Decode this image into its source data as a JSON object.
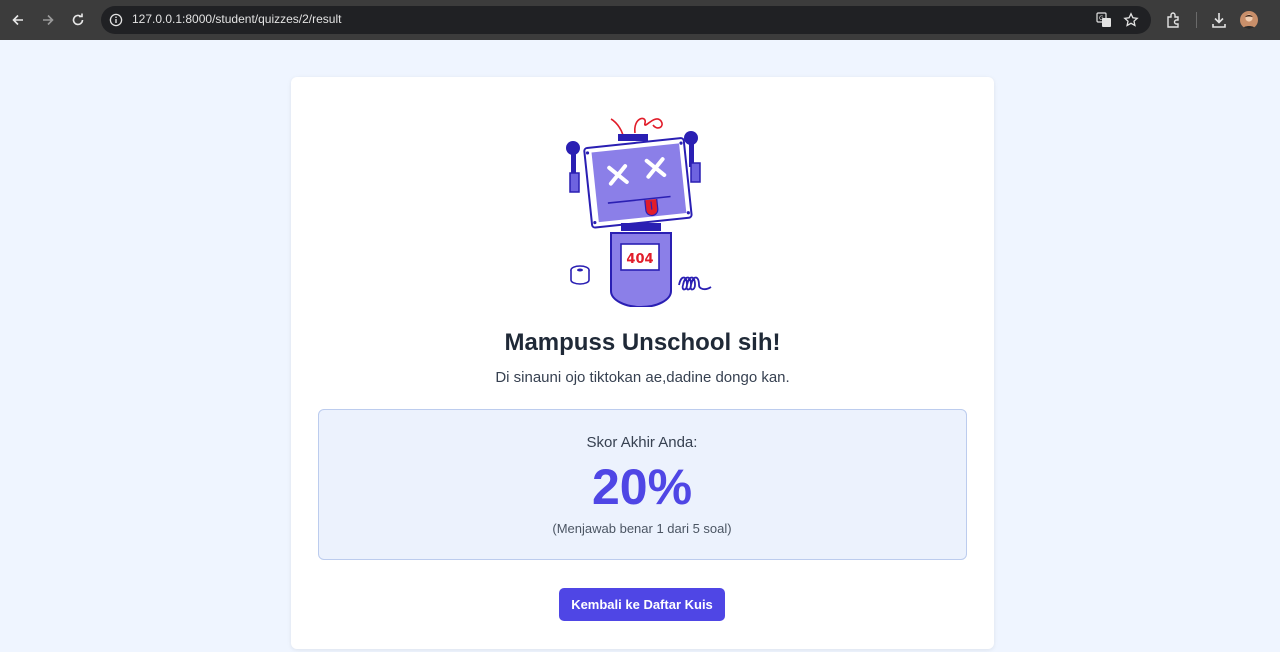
{
  "browser": {
    "url": "127.0.0.1:8000/student/quizzes/2/result",
    "icons": [
      "back-icon",
      "forward-icon",
      "reload-icon",
      "site-info-icon",
      "translate-icon",
      "star-icon",
      "extensions-icon",
      "download-icon",
      "profile-avatar"
    ]
  },
  "result": {
    "illustration_label": "404",
    "title": "Mampuss Unschool sih!",
    "subtitle": "Di sinauni ojo tiktokan ae,dadine dongo kan.",
    "score_label": "Skor Akhir Anda:",
    "score_value": "20%",
    "score_detail": "(Menjawab benar 1 dari 5 soal)",
    "back_button": "Kembali ke Daftar Kuis"
  },
  "colors": {
    "accent": "#4f46e5",
    "page_bg": "#eff5ff",
    "robot_body": "#8b7fe8",
    "robot_outline": "#2a1fb3",
    "error_red": "#e11d2a"
  }
}
